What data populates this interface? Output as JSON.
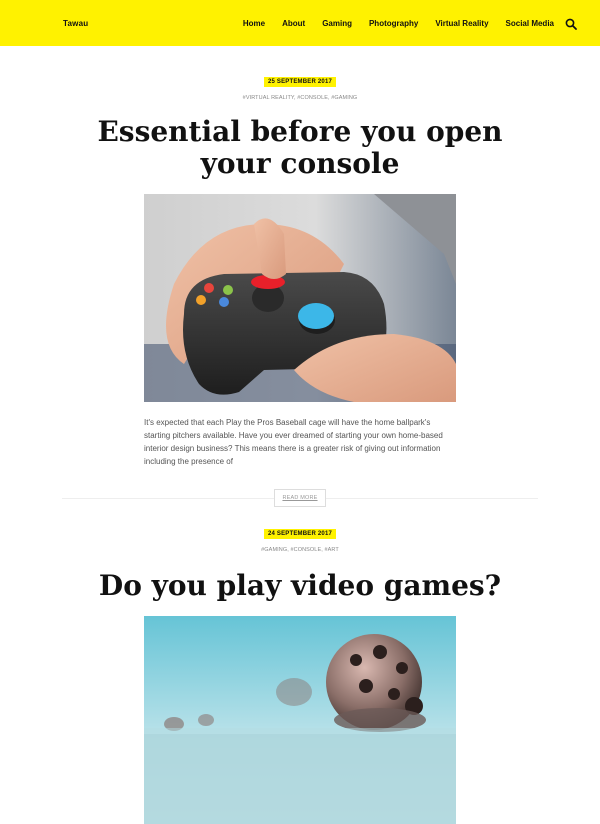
{
  "header": {
    "site_title": "Tawau",
    "nav": [
      "Home",
      "About",
      "Gaming",
      "Photography",
      "Virtual Reality",
      "Social Media"
    ],
    "icon": "search-icon"
  },
  "posts": [
    {
      "date": "25 SEPTEMBER 2017",
      "tags": "#VIRTUAL REALITY, #CONSOLE, #GAMING",
      "title": "Essential before you open your console",
      "excerpt": "It's expected that each Play the Pros Baseball cage will have the home ballpark's starting pitchers available. Have you ever dreamed of starting your own home-based interior design business? This means there is a greater risk of giving out information including the presence of",
      "read_more": "READ MORE"
    },
    {
      "date": "24 SEPTEMBER 2017",
      "tags": "#GAMING, #CONSOLE, #ART",
      "title": "Do you play video games?"
    }
  ],
  "colors": {
    "accent": "#fff200",
    "text": "#111111",
    "muted": "#888888"
  }
}
